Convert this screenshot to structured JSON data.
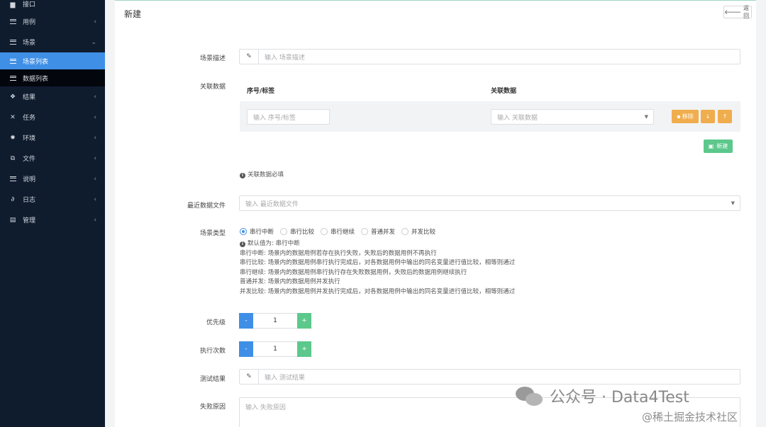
{
  "sidebar": {
    "items": [
      {
        "label": "接口",
        "icon": "api-icon",
        "partial": true
      },
      {
        "label": "用例",
        "icon": "list-icon"
      },
      {
        "label": "场景",
        "icon": "list-icon",
        "expanded": true
      },
      {
        "label": "结果",
        "icon": "cubes-icon"
      },
      {
        "label": "任务",
        "icon": "tasks-icon"
      },
      {
        "label": "环境",
        "icon": "gear-icon"
      },
      {
        "label": "文件",
        "icon": "copy-icon"
      },
      {
        "label": "说明",
        "icon": "list-icon"
      },
      {
        "label": "日志",
        "icon": "paperclip-icon"
      },
      {
        "label": "管理",
        "icon": "card-icon"
      }
    ],
    "sub_items": [
      {
        "label": "场景列表",
        "active": true
      },
      {
        "label": "数据列表",
        "active": false
      }
    ]
  },
  "page": {
    "title": "新建",
    "back_label": "返回"
  },
  "form": {
    "scene_desc": {
      "label": "场景描述",
      "placeholder": "输入 场景描述"
    },
    "assoc": {
      "label": "关联数据",
      "col_seq": "序号/标签",
      "col_data": "关联数据",
      "seq_placeholder": "输入 序号/标签",
      "data_placeholder": "输入 关联数据",
      "remove_label": "移除",
      "add_label": "新建",
      "required_note": "关联数据必填"
    },
    "recent_file": {
      "label": "最近数据文件",
      "placeholder": "输入 最近数据文件"
    },
    "scene_type": {
      "label": "场景类型",
      "options": [
        "串行中断",
        "串行比较",
        "串行继续",
        "普通并发",
        "并发比较"
      ],
      "selected": "串行中断",
      "default_note": "默认值为: 串行中断",
      "descriptions": [
        "串行中断: 场景内的数据用例若存在执行失败，失败后的数据用例不再执行",
        "串行比较: 场景内的数据用例串行执行完成后，对各数据用例中输出的同名变量进行值比较，相等则通过",
        "串行继续: 场景内的数据用例串行执行存在失败数据用例，失败后的数据用例继续执行",
        "普通并发: 场景内的数据用例并发执行",
        "并发比较: 场景内的数据用例并发执行完成后，对各数据用例中输出的同名变量进行值比较，相等则通过"
      ]
    },
    "priority": {
      "label": "优先级",
      "value": "1",
      "minus": "-",
      "plus": "+"
    },
    "exec_count": {
      "label": "执行次数",
      "value": "1",
      "minus": "-",
      "plus": "+"
    },
    "test_result": {
      "label": "测试结果",
      "placeholder": "输入 测试结果"
    },
    "fail_reason": {
      "label": "失败原因",
      "placeholder": "输入 失败原因"
    }
  },
  "watermark": {
    "text": "公众号 · Data4Test",
    "site": "@稀土掘金技术社区"
  }
}
